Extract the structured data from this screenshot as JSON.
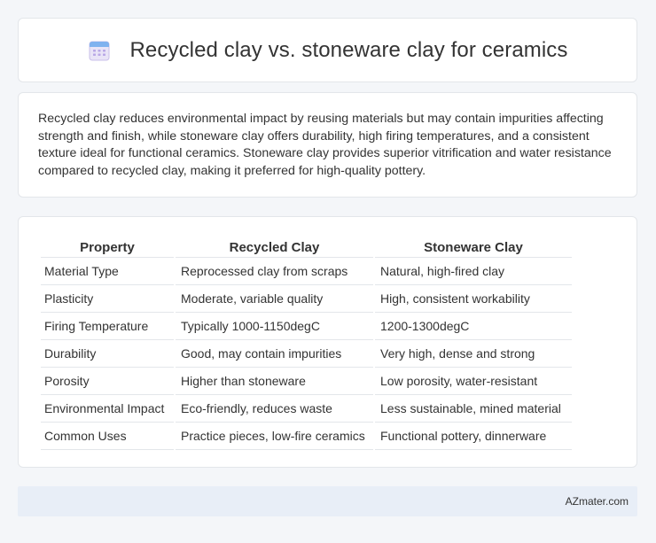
{
  "header": {
    "title": "Recycled clay vs. stoneware clay for ceramics",
    "icon": "calendar-icon"
  },
  "summary": {
    "text": "Recycled clay reduces environmental impact by reusing materials but may contain impurities affecting strength and finish, while stoneware clay offers durability, high firing temperatures, and a consistent texture ideal for functional ceramics. Stoneware clay provides superior vitrification and water resistance compared to recycled clay, making it preferred for high-quality pottery."
  },
  "table": {
    "headers": [
      "Property",
      "Recycled Clay",
      "Stoneware Clay"
    ],
    "rows": [
      [
        "Material Type",
        "Reprocessed clay from scraps",
        "Natural, high-fired clay"
      ],
      [
        "Plasticity",
        "Moderate, variable quality",
        "High, consistent workability"
      ],
      [
        "Firing Temperature",
        "Typically 1000-1150degC",
        "1200-1300degC"
      ],
      [
        "Durability",
        "Good, may contain impurities",
        "Very high, dense and strong"
      ],
      [
        "Porosity",
        "Higher than stoneware",
        "Low porosity, water-resistant"
      ],
      [
        "Environmental Impact",
        "Eco-friendly, reduces waste",
        "Less sustainable, mined material"
      ],
      [
        "Common Uses",
        "Practice pieces, low-fire ceramics",
        "Functional pottery, dinnerware"
      ]
    ]
  },
  "footer": {
    "brand": "AZmater.com"
  }
}
